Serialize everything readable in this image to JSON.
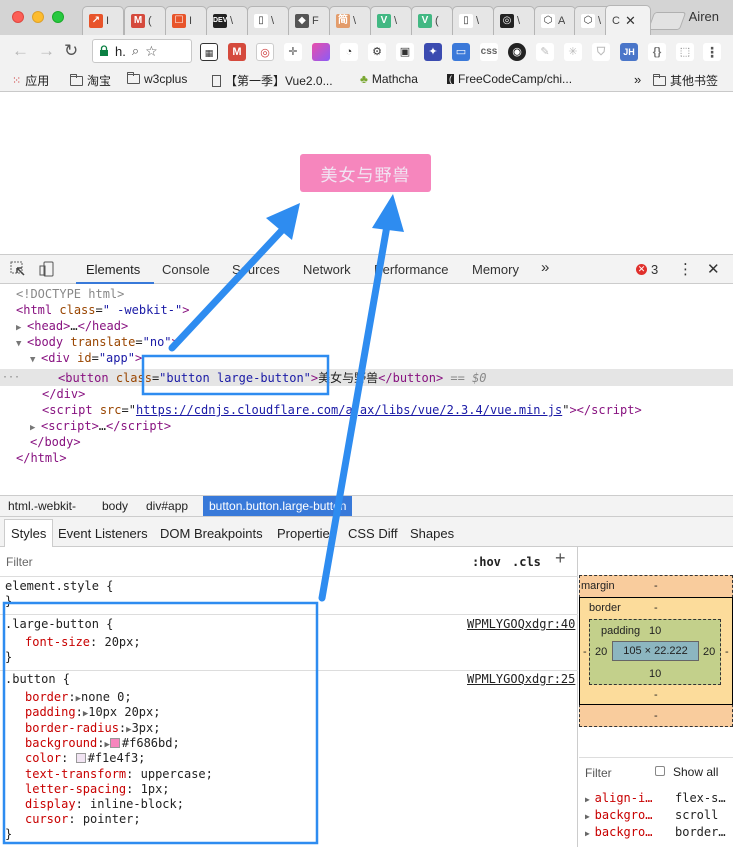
{
  "browser": {
    "tabs": [
      {
        "label": "I",
        "fav": "#e8542a",
        "glyph": "↗"
      },
      {
        "label": "(",
        "fav": "#d54a3d",
        "glyph": "M"
      },
      {
        "label": "I",
        "fav": "#e8542a",
        "glyph": "☐"
      },
      {
        "label": "\\",
        "fav": "#222222",
        "glyph": "DEV"
      },
      {
        "label": "\\",
        "fav": "#ffffff",
        "glyph": "▯"
      },
      {
        "label": "F",
        "fav": "#555555",
        "glyph": "◆"
      },
      {
        "label": "\\",
        "fav": "#e39c6b",
        "glyph": "简"
      },
      {
        "label": "\\",
        "fav": "#42b883",
        "glyph": "V"
      },
      {
        "label": "(",
        "fav": "#42b883",
        "glyph": "V"
      },
      {
        "label": "\\",
        "fav": "#ffffff",
        "glyph": "▯"
      },
      {
        "label": "\\",
        "fav": "#222222",
        "glyph": "◎"
      },
      {
        "label": "А",
        "fav": "#ffffff",
        "glyph": "⬡"
      },
      {
        "label": "\\",
        "fav": "#ffffff",
        "glyph": "⬡"
      }
    ],
    "active_tab_label": "C",
    "profile_name": "Airen",
    "url_short": "h."
  },
  "bookmarks": [
    {
      "label": "应用",
      "icon": "apps-grid-icon"
    },
    {
      "label": "淘宝",
      "icon": "folder-icon"
    },
    {
      "label": "w3cplus",
      "icon": "folder-icon"
    },
    {
      "label": "【第一季】Vue2.0...",
      "icon": "page-icon"
    },
    {
      "label": "Mathcha",
      "icon": "mathcha-icon"
    },
    {
      "label": "FreeCodeCamp/chi...",
      "icon": "freecodecamp-icon"
    }
  ],
  "bookmarks_more": "»",
  "other_bookmarks": "其他书签",
  "page": {
    "button_text": "美女与野兽"
  },
  "devtools": {
    "tabs": [
      "Elements",
      "Console",
      "Sources",
      "Network",
      "Performance",
      "Memory"
    ],
    "more": "»",
    "error_count": "3",
    "dom": {
      "doctype": "<!DOCTYPE html>",
      "html_open_tag": "html",
      "html_class_attr": "class",
      "html_class_val": "\" -webkit-\"",
      "head": "…",
      "body_attr": "translate",
      "body_attr_val": "\"no\"",
      "div_attr": "id",
      "div_attr_val": "\"app\"",
      "button_attr": "class",
      "button_attr_val": "\"button large-button\"",
      "button_text": "美女与野兽",
      "selected_marker": "== $0",
      "script_attr": "src",
      "script_src": "https://cdnjs.cloudflare.com/ajax/libs/vue/2.3.4/vue.min.js",
      "script2": "…"
    },
    "breadcrumbs": [
      "html.-webkit-",
      "body",
      "div#app",
      "button.button.large-button"
    ],
    "subtabs": [
      "Styles",
      "Event Listeners",
      "DOM Breakpoints",
      "Properties",
      "CSS Diff",
      "Shapes"
    ],
    "filter_placeholder": "Filter",
    "hov": ":hov",
    "cls": ".cls",
    "element_style": "element.style {",
    "rule1": {
      "selector": ".large-button {",
      "source": "WPMLYGOQxdgr:40",
      "props": [
        {
          "name": "font-size",
          "value": "20px;"
        }
      ]
    },
    "rule2": {
      "selector": ".button {",
      "source": "WPMLYGOQxdgr:25",
      "props": [
        {
          "name": "border",
          "value": "none 0;",
          "expand": true
        },
        {
          "name": "padding",
          "value": "10px 20px;",
          "expand": true
        },
        {
          "name": "border-radius",
          "value": "3px;",
          "expand": true
        },
        {
          "name": "background",
          "value": "#f686bd;",
          "expand": true,
          "swatch": "#f686bd"
        },
        {
          "name": "color",
          "value": "#f1e4f3;",
          "swatch": "#f1e4f3"
        },
        {
          "name": "text-transform",
          "value": "uppercase;"
        },
        {
          "name": "letter-spacing",
          "value": "1px;"
        },
        {
          "name": "display",
          "value": "inline-block;"
        },
        {
          "name": "cursor",
          "value": "pointer;"
        }
      ]
    },
    "box_model": {
      "margin_label": "margin",
      "margin_val": "-",
      "border_label": "border",
      "border_val": "-",
      "padding_label": "padding",
      "padding_val": "10",
      "padding_side": "20",
      "padding_bottom": "10",
      "content": "105 × 22.222",
      "dash": "-"
    },
    "computed": {
      "filter": "Filter",
      "show_all": "Show all",
      "rows": [
        {
          "name": "align-i…",
          "value": "flex-s…"
        },
        {
          "name": "backgro…",
          "value": "scroll"
        },
        {
          "name": "backgro…",
          "value": "border…"
        }
      ]
    }
  },
  "colors": {
    "accent": "#3879d9",
    "annotation": "#2e8cf0",
    "button_bg": "#f686bd",
    "button_fg": "#f1e4f3"
  }
}
